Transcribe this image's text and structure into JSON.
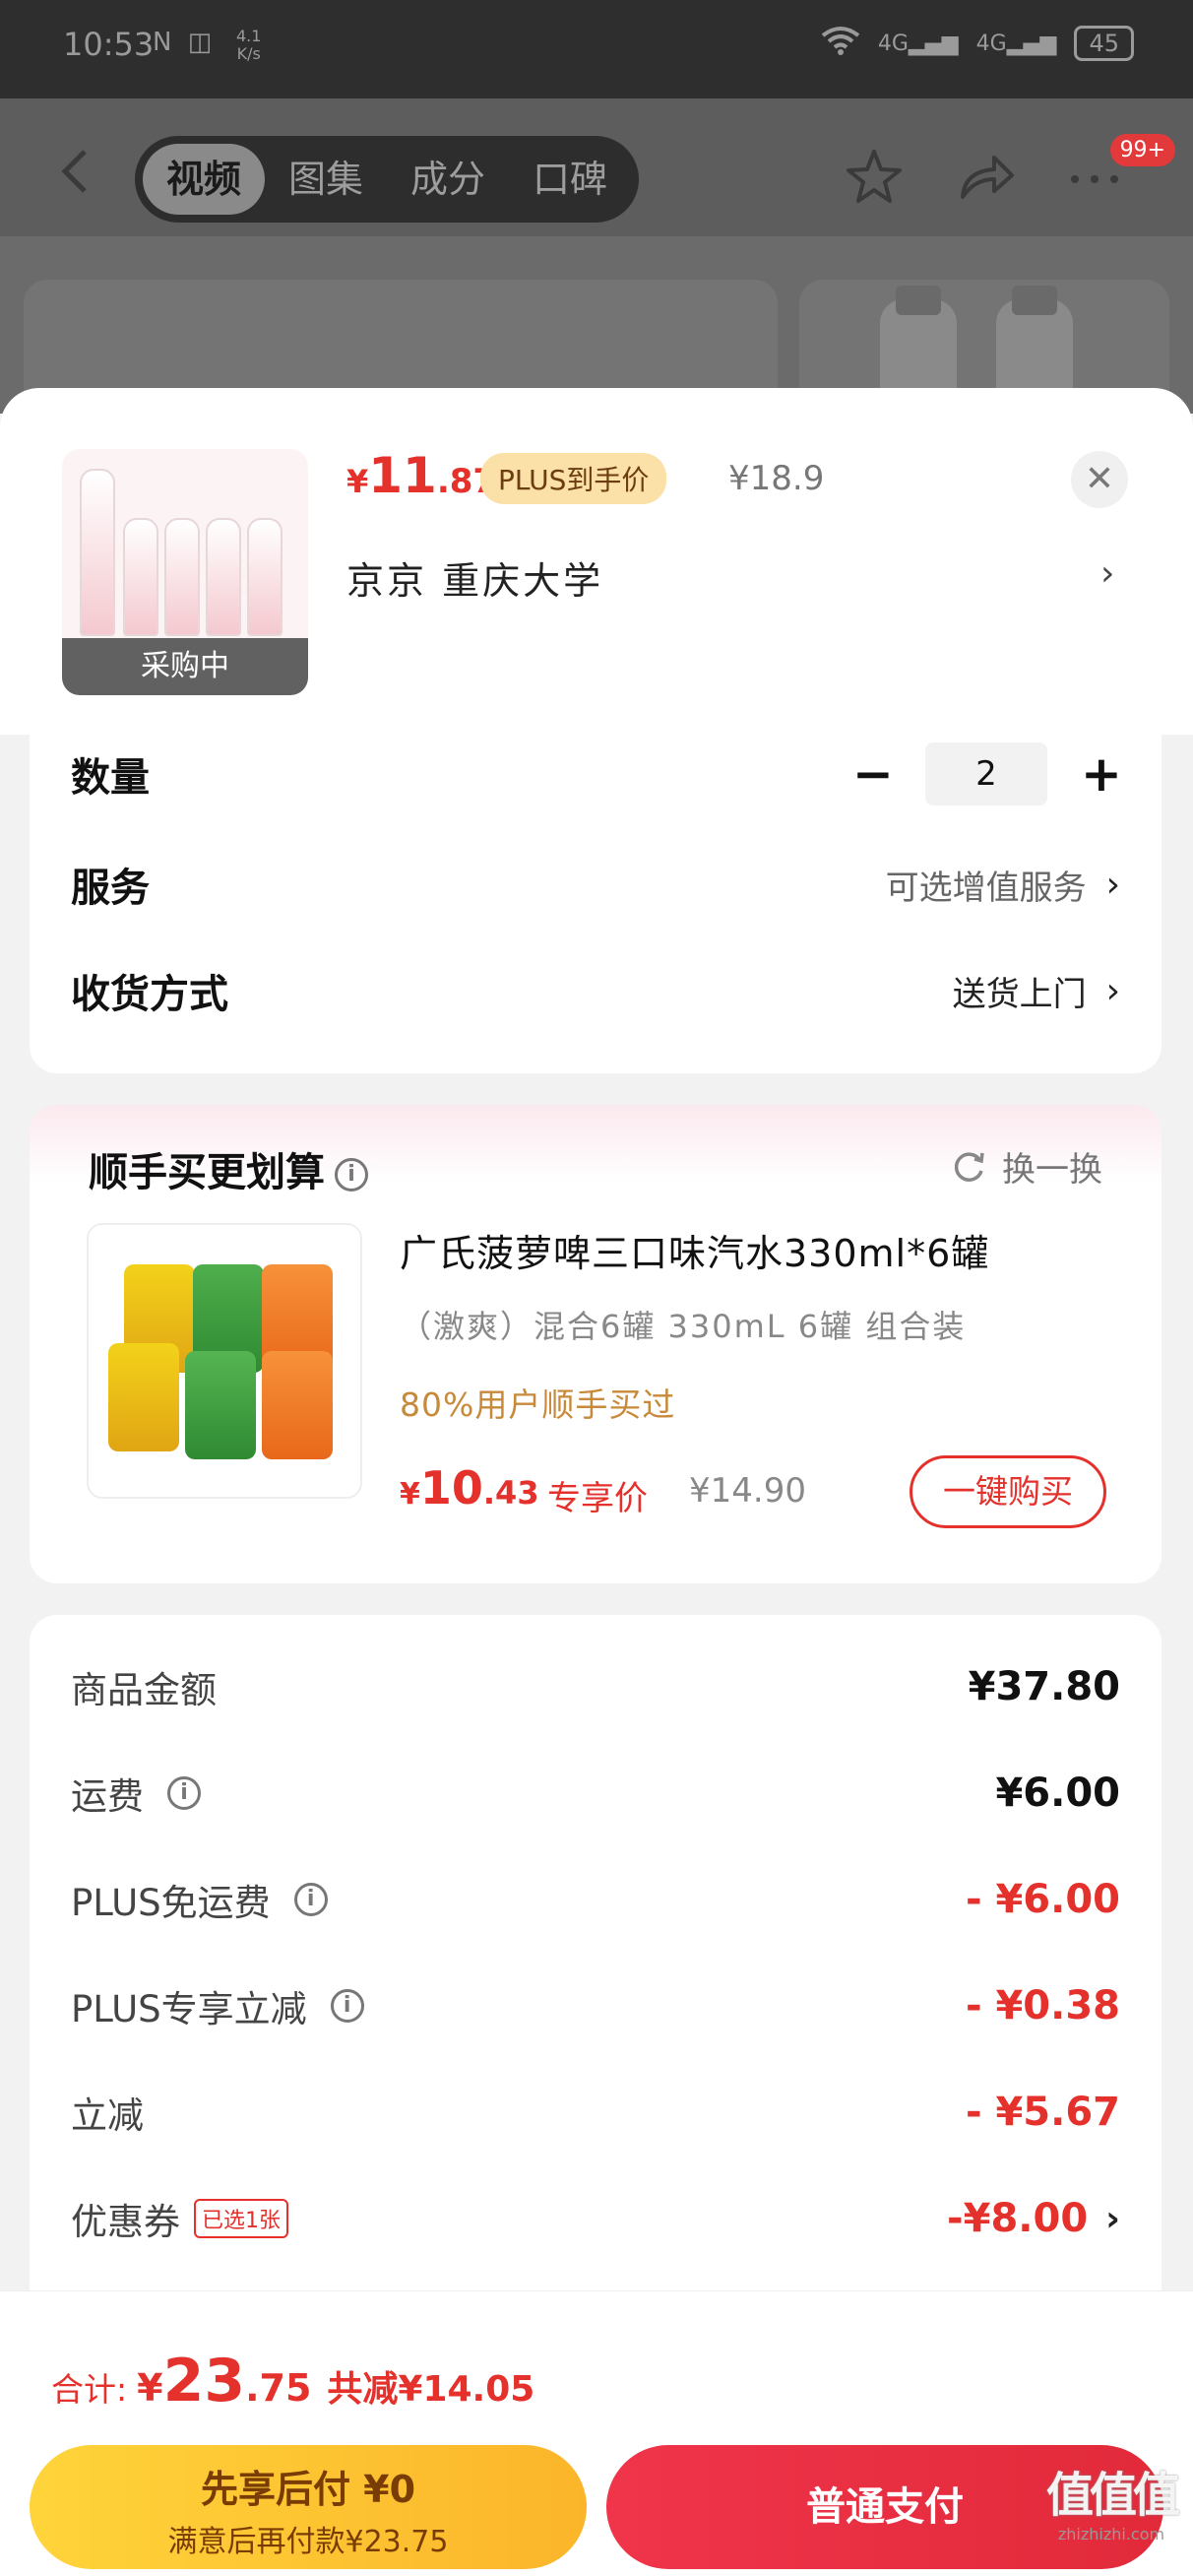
{
  "status_bar": {
    "time": "10:53",
    "net_speed": "4.1",
    "net_unit": "K/s",
    "battery": "45",
    "signal_1": "4G",
    "signal_2": "4G"
  },
  "top_nav": {
    "tabs": [
      "视频",
      "图集",
      "成分",
      "口碑"
    ],
    "active_tab": 0,
    "badge": "99+"
  },
  "product": {
    "price_yen": "¥",
    "price_int": "11",
    "price_dec": ".87",
    "plus_tag": "PLUS到手价",
    "original_price": "¥18.9",
    "address": "京京  重庆大学",
    "thumb_label": "采购中",
    "close_icon": "close-icon"
  },
  "options": {
    "quantity_label": "数量",
    "quantity_value": "2",
    "service_label": "服务",
    "service_value": "可选增值服务",
    "delivery_label": "收货方式",
    "delivery_value": "送货上门"
  },
  "bundle": {
    "title": "顺手买更划算",
    "refresh_label": "换一换",
    "name": "广氏菠萝啤三口味汽水330ml*6罐",
    "spec": "（激爽）混合6罐  330mL  6罐  组合装",
    "note": "80%用户顺手买过",
    "price_yen": "¥",
    "price_int": "10",
    "price_dec": ".43",
    "price_tag": "专享价",
    "original_price": "¥14.90",
    "buy_label": "一键购买"
  },
  "summary": {
    "rows": [
      {
        "label": "商品金额",
        "value": "¥37.80"
      },
      {
        "label": "运费",
        "value": "¥6.00"
      },
      {
        "label": "PLUS免运费",
        "value": "- ¥6.00"
      },
      {
        "label": "PLUS专享立减",
        "value": "- ¥0.38"
      },
      {
        "label": "立减",
        "value": "- ¥5.67"
      },
      {
        "label": "优惠券",
        "value": "-¥8.00",
        "tag": "已选1张"
      }
    ]
  },
  "bottom_bar": {
    "total_label": "合计:",
    "total_yen": "¥",
    "total_int": "23",
    "total_dec": ".75",
    "total_saved": "共减¥14.05",
    "pay_later_line1": "先享后付 ¥0",
    "pay_later_line2": "满意后再付款¥23.75",
    "pay_normal": "普通支付"
  },
  "watermark": {
    "mark": "值值值",
    "site": "zhizhizhi.com"
  },
  "colors": {
    "accent_red": "#e4312c",
    "plus_gold": "#fbe0a8",
    "pay_later_yellow": "#ffd43a",
    "pay_normal_red": "#e12a3a"
  }
}
